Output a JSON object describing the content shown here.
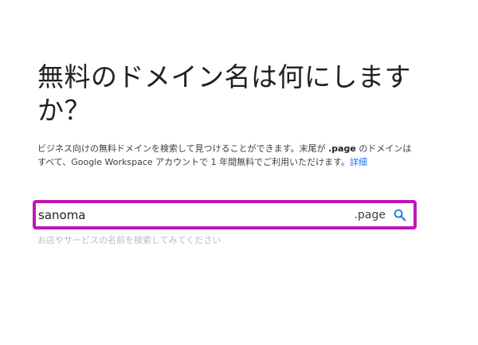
{
  "heading": "無料のドメイン名は何にしますか？",
  "description": {
    "text_before": "ビジネス向けの無料ドメインを検索して見つけることができます。末尾が ",
    "suffix_bold": ".page",
    "text_after": " のドメインはすべて、Google Workspace アカウントで 1 年間無料でご利用いただけます。",
    "link_label": "詳細"
  },
  "search": {
    "value": "sanoma",
    "suffix": ".page",
    "icon": "search-icon",
    "hint": "お店やサービスの名前を検索してみてください"
  },
  "colors": {
    "highlight_border": "#c016b5",
    "link": "#1a73e8",
    "search_icon": "#1a73e8",
    "hint_text": "#b8bbbf"
  }
}
